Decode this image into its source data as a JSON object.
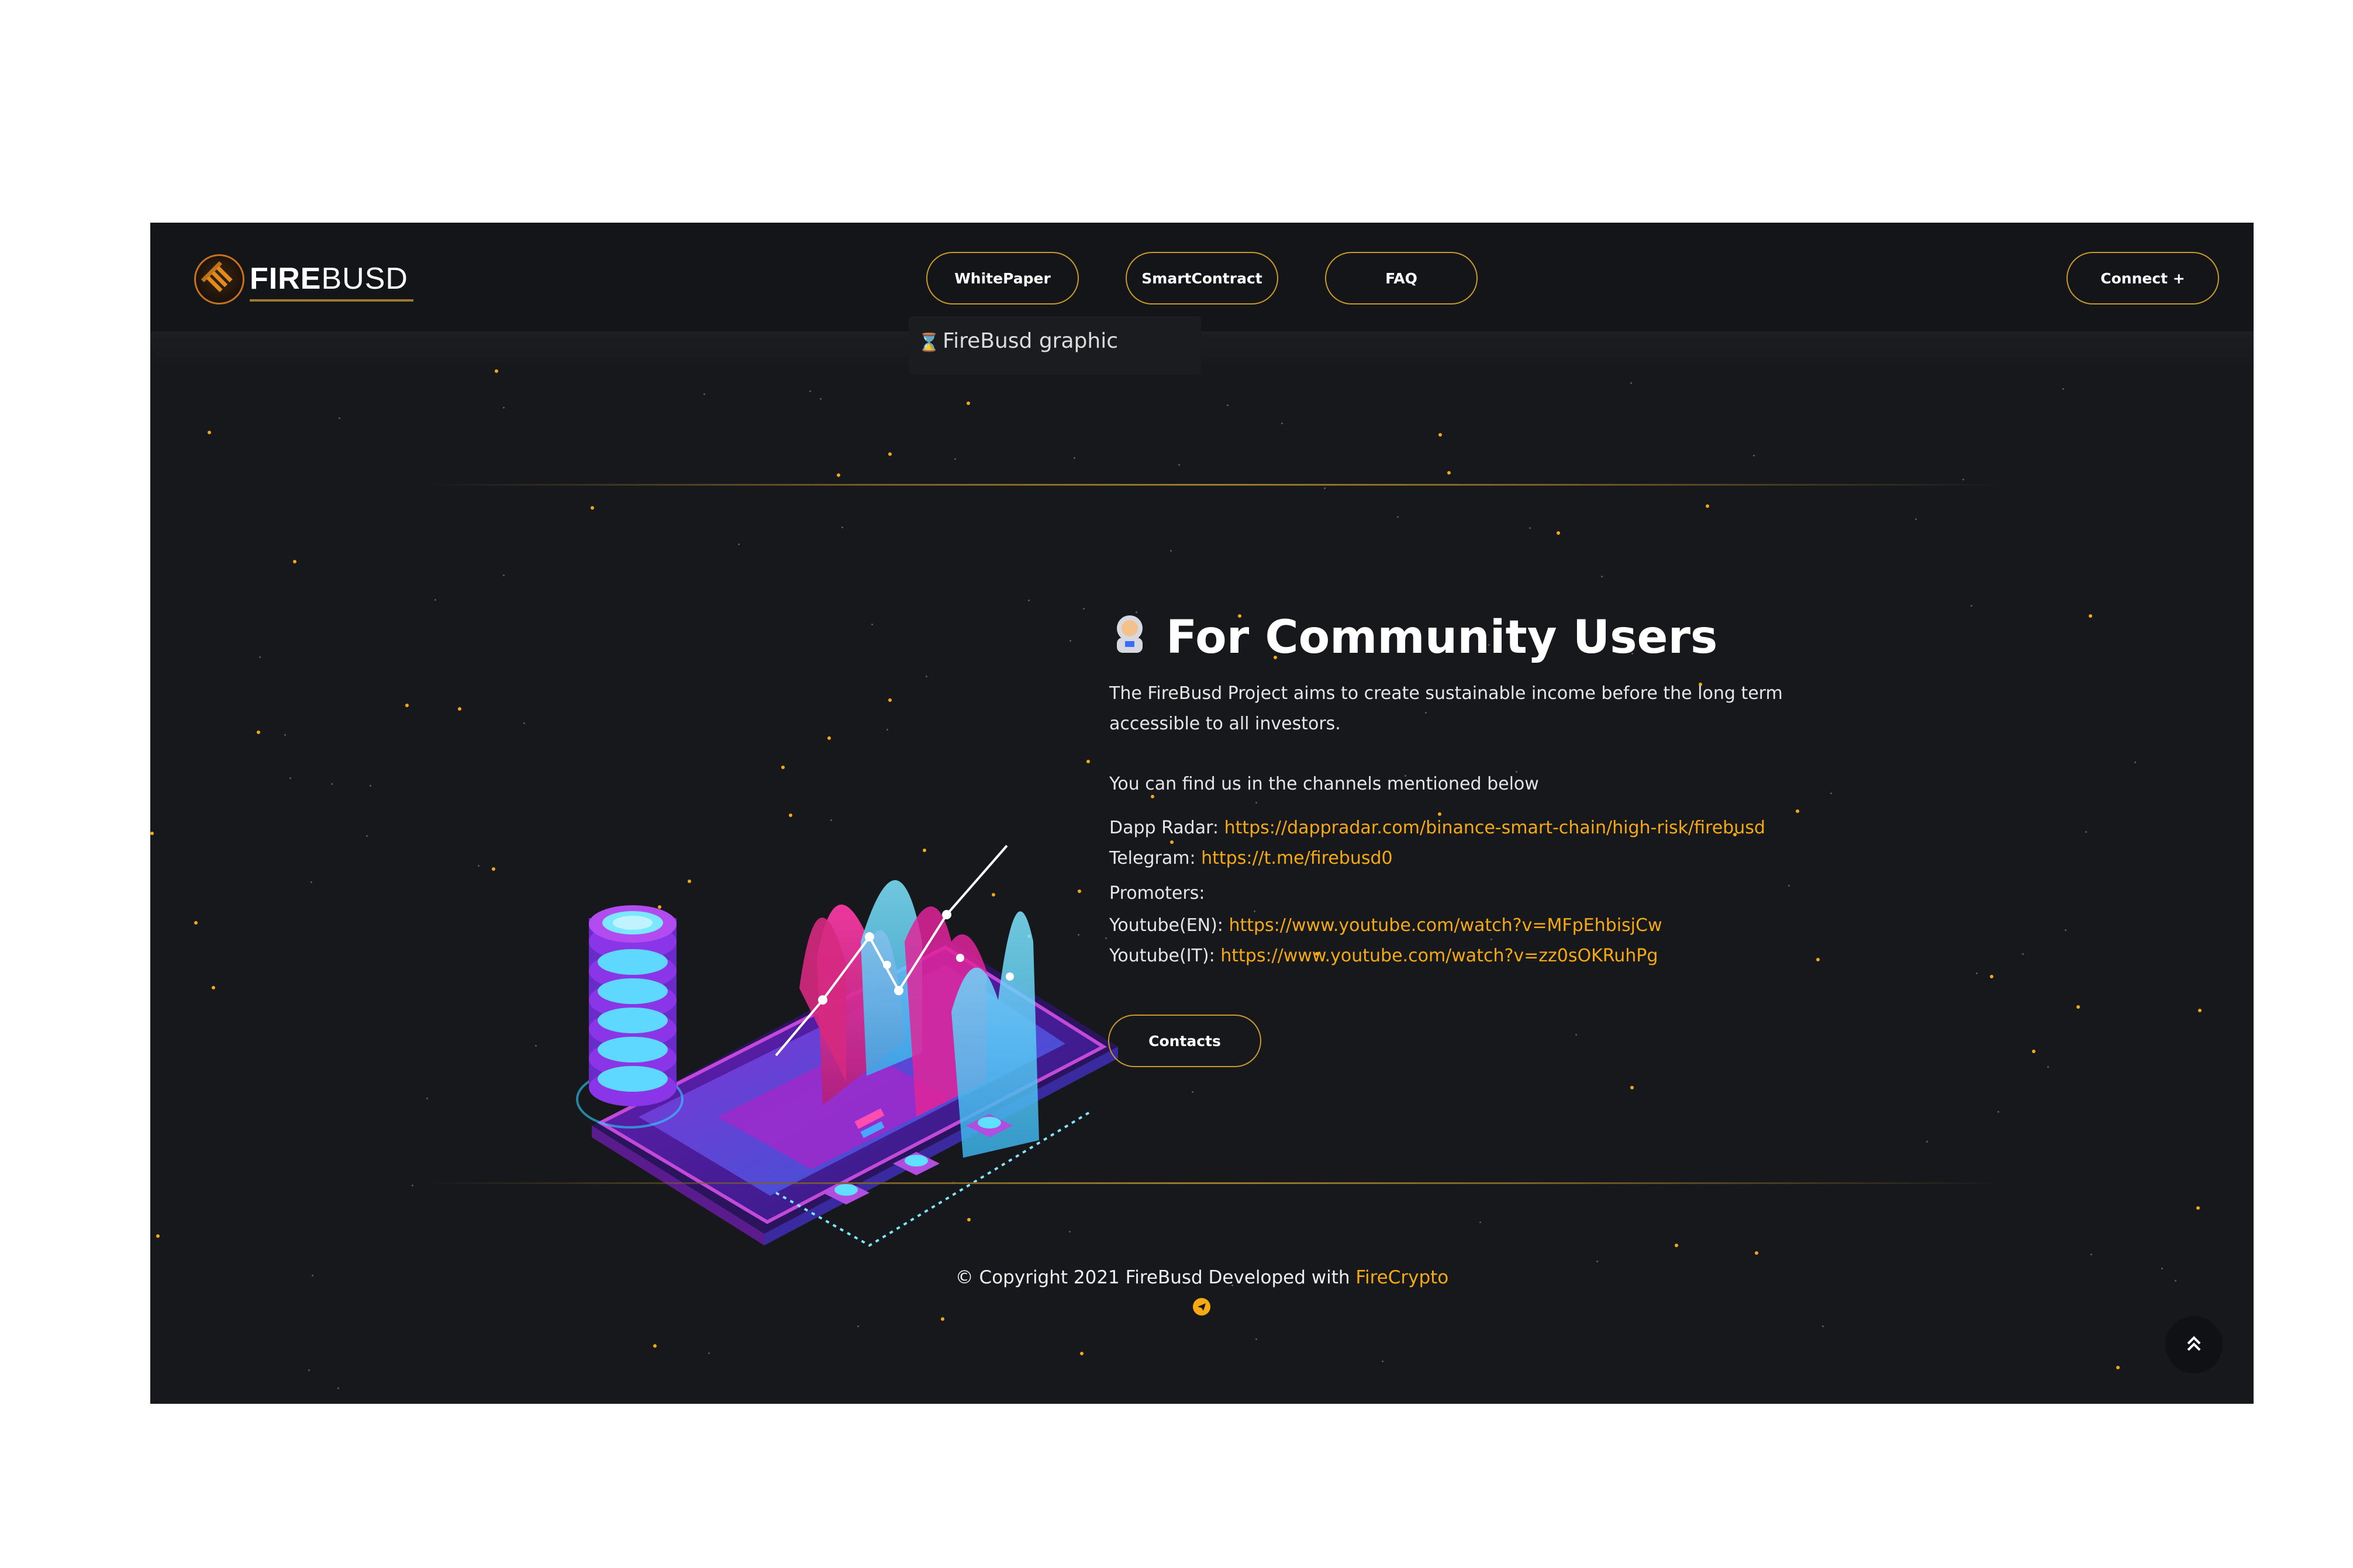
{
  "header": {
    "logo_bold": "FIRE",
    "logo_light": "BUSD",
    "nav": {
      "whitepaper": "WhitePaper",
      "smartcontract": "SmartContract",
      "faq": "FAQ",
      "connect": "Connect +"
    },
    "broken_image_alt": "FireBusd graphic"
  },
  "community": {
    "title": "For Community Users",
    "intro": "The FireBusd Project aims to create sustainable income before the long term accessible to all investors.",
    "channels_intro": "You can find us in the channels mentioned below",
    "dapp_label": "Dapp Radar:",
    "dapp_url": "https://dappradar.com/binance-smart-chain/high-risk/firebusd",
    "telegram_label": "Telegram:",
    "telegram_url": "https://t.me/firebusd0",
    "promoters_label": "Promoters:",
    "yt_en_label": "Youtube(EN):",
    "yt_en_url": "https://www.youtube.com/watch?v=MFpEhbisjCw",
    "yt_it_label": "Youtube(IT):",
    "yt_it_url": "https://www.youtube.com/watch?v=zz0sOKRuhPg",
    "contacts_button": "Contacts"
  },
  "footer": {
    "copyright": "© Copyright 2021 FireBusd Developed with",
    "credit_link": "FireCrypto"
  },
  "colors": {
    "background": "#17181c",
    "accent": "#f5a913",
    "button_border": "#c99a2a"
  },
  "icons": [
    "firebusd-logo-icon",
    "hourglass-icon",
    "astronaut-icon",
    "telegram-icon",
    "double-chevron-up-icon"
  ]
}
